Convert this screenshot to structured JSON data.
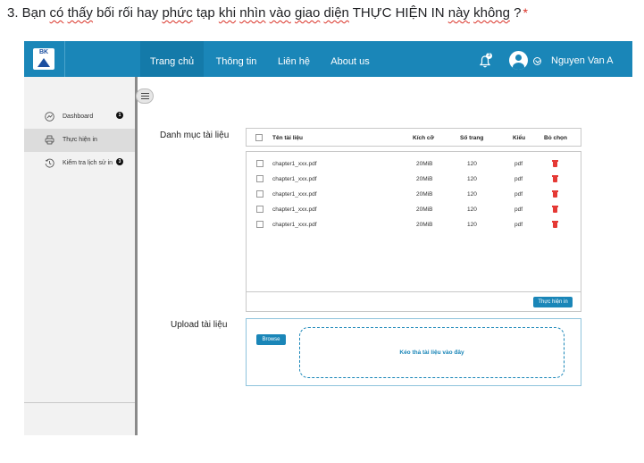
{
  "question": {
    "prefix": "3. Bạn ",
    "w1": "có",
    "sp1": " ",
    "w2": "thấy",
    "mid1": " bối rối hay ",
    "w3": "phức",
    "mid2": " tạp ",
    "w4": "khi",
    "mid3": " ",
    "w5": "nhìn",
    "sp2": " ",
    "w6": "vào",
    "sp3": " ",
    "w7": "giao",
    "sp4": " ",
    "w8": "diện",
    "mid4": " THỰC HIỆN IN ",
    "w9": "này",
    "sp5": " ",
    "w10": "không",
    "suffix": " ?",
    "required": "*"
  },
  "header": {
    "logo_text": "BK",
    "nav": [
      "Trang chủ",
      "Thông tin",
      "Liên hệ",
      "About us"
    ],
    "active_nav": "Trang chủ",
    "notification_count": "3",
    "username": "Nguyen Van A"
  },
  "sidebar": {
    "items": [
      {
        "label": "Dashboard",
        "icon": "dashboard-icon",
        "badge": "1"
      },
      {
        "label": "Thực hiện in",
        "icon": "printer-icon",
        "badge": ""
      },
      {
        "label": "Kiểm tra lịch sử in",
        "icon": "history-icon",
        "badge": "3"
      }
    ],
    "logout_icon": "logout-icon"
  },
  "documents": {
    "section_label": "Danh mục tài liệu",
    "columns": [
      "Tên tài liệu",
      "Kích cỡ",
      "Số trang",
      "Kiểu",
      "Bỏ chọn"
    ],
    "rows": [
      {
        "name": "chapter1_xxx.pdf",
        "size": "20MiB",
        "pages": "120",
        "type": "pdf"
      },
      {
        "name": "chapter1_xxx.pdf",
        "size": "20MiB",
        "pages": "120",
        "type": "pdf"
      },
      {
        "name": "chapter1_xxx.pdf",
        "size": "20MiB",
        "pages": "120",
        "type": "pdf"
      },
      {
        "name": "chapter1_xxx.pdf",
        "size": "20MiB",
        "pages": "120",
        "type": "pdf"
      },
      {
        "name": "chapter1_xxx.pdf",
        "size": "20MiB",
        "pages": "120",
        "type": "pdf"
      }
    ],
    "execute_button": "Thực hiện in"
  },
  "upload": {
    "section_label": "Upload tài liệu",
    "browse_button": "Browse",
    "drop_text": "Kéo thả tài liệu vào đây"
  },
  "colors": {
    "primary": "#1a86b8",
    "danger": "#e53935"
  }
}
